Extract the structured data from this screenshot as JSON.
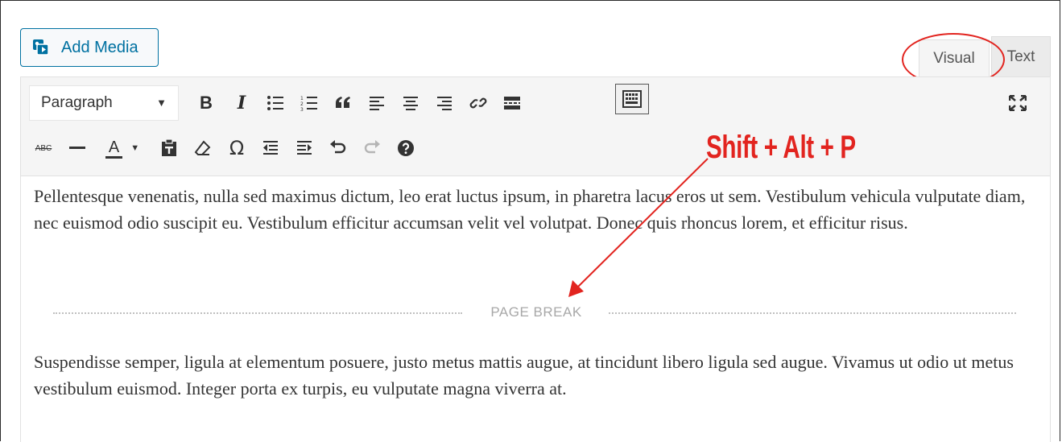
{
  "media_button": {
    "label": "Add Media",
    "icon": "add-media-icon"
  },
  "tabs": {
    "visual": "Visual",
    "text": "Text"
  },
  "toolbar": {
    "format_value": "Paragraph",
    "row1_icons": [
      "bold-icon",
      "italic-icon",
      "bulleted-list-icon",
      "numbered-list-icon",
      "blockquote-icon",
      "align-left-icon",
      "align-center-icon",
      "align-right-icon",
      "link-icon",
      "read-more-icon",
      "toolbar-toggle-icon",
      "fullscreen-icon"
    ],
    "row2_icons": [
      "strikethrough-icon",
      "horizontal-line-icon",
      "text-color-icon",
      "paste-as-text-icon",
      "clear-formatting-icon",
      "special-character-icon",
      "outdent-icon",
      "indent-icon",
      "undo-icon",
      "redo-icon",
      "help-icon"
    ],
    "bold_glyph": "B",
    "italic_glyph": "I",
    "text_color_glyph": "A",
    "special_char_glyph": "Ω",
    "strike_glyph": "ABC"
  },
  "content": {
    "paragraph_1": "Pellentesque venenatis, nulla sed maximus dictum, leo erat luctus ipsum, in pharetra lacus eros ut sem. Vestibulum vehicula vulputate diam, nec euismod odio suscipit eu. Vestibulum efficitur accumsan velit vel volutpat. Donec quis rhoncus lorem, et efficitur risus.",
    "page_break_label": "PAGE BREAK",
    "paragraph_2": "Suspendisse semper, ligula at elementum posuere, justo metus mattis augue, at tincidunt libero ligula sed augue. Vivamus ut odio ut metus vestibulum euismod. Integer porta ex turpis, eu vulputate magna viverra at."
  },
  "annotation": {
    "shortcut": "Shift + Alt + P",
    "color": "#e2241f"
  },
  "colors": {
    "accent": "#0071a1",
    "toolbar_bg": "#f5f5f5",
    "annotation_red": "#e2241f"
  }
}
